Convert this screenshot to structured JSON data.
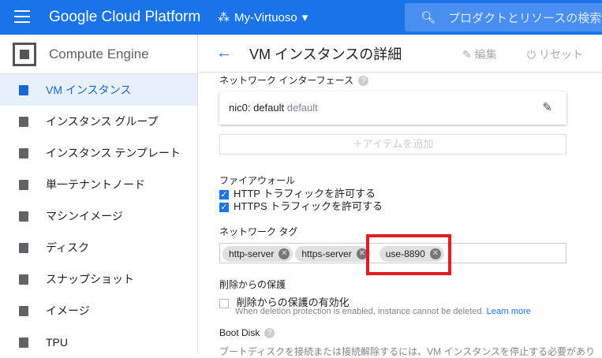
{
  "topbar": {
    "brand": "Google Cloud Platform",
    "project": "My-Virtuoso",
    "search_placeholder": "プロダクトとリソースの検索"
  },
  "sidebar": {
    "title": "Compute Engine",
    "items": [
      {
        "label": "VM インスタンス",
        "active": true
      },
      {
        "label": "インスタンス グループ"
      },
      {
        "label": "インスタンス テンプレート"
      },
      {
        "label": "単一テナントノード"
      },
      {
        "label": "マシンイメージ"
      },
      {
        "label": "ディスク"
      },
      {
        "label": "スナップショット"
      },
      {
        "label": "イメージ"
      },
      {
        "label": "TPU"
      }
    ]
  },
  "header": {
    "title": "VM インスタンスの詳細",
    "edit": "編集",
    "reset": "リセット"
  },
  "network_interface": {
    "label": "ネットワーク インターフェース",
    "nic": "nic0: default",
    "nic_sub": "default",
    "add_item": "アイテムを追加"
  },
  "firewall": {
    "label": "ファイアウォール",
    "http": "HTTP トラフィックを許可する",
    "https": "HTTPS トラフィックを許可する",
    "http_checked": true,
    "https_checked": true
  },
  "network_tags": {
    "label": "ネットワーク タグ",
    "tags": [
      "http-server",
      "https-server",
      "use-8890"
    ]
  },
  "deletion": {
    "label": "削除からの保護",
    "checkbox": "削除からの保護の有効化",
    "note": "When deletion protection is enabled, instance cannot be deleted.",
    "learn_more": "Learn more"
  },
  "boot_disk": {
    "label": "Boot Disk",
    "text": "ブートディスクを接続または接続解除するには、VM インスタンスを停止する必要があり"
  }
}
